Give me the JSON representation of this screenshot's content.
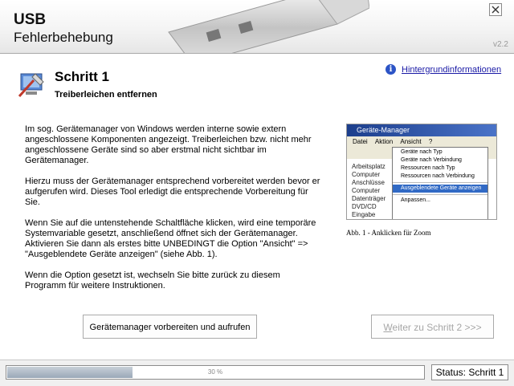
{
  "header": {
    "title": "USB",
    "subtitle": "Fehlerbehebung",
    "version": "v2.2",
    "close_glyph": "×"
  },
  "step": {
    "title": "Schritt 1",
    "subtitle": "Treiberleichen entfernen",
    "info_link": "Hintergrundinformationen",
    "info_glyph": "i"
  },
  "body": {
    "paragraphs": [
      "Im sog. Gerätemanager von Windows werden interne sowie extern angeschlossene Komponenten angezeigt. Treiberleichen bzw. nicht mehr angeschlossene Geräte sind so aber erstmal nicht sichtbar im Gerätemanager.",
      "Hierzu muss der Gerätemanager entsprechend vorbereitet werden bevor er aufgerufen wird. Dieses Tool erledigt die entsprechende Vorbereitung für Sie.",
      "Wenn Sie auf die untenstehende Schaltfläche klicken, wird eine temporäre Systemvariable gesetzt, anschließend öffnet sich der Gerätemanager. Aktivieren Sie dann als erstes bitte UNBEDINGT die Option \"Ansicht\" => \"Ausgeblendete Geräte anzeigen\" (siehe Abb. 1).",
      "Wenn die Option gesetzt ist, wechseln Sie bitte zurück zu diesem Programm für weitere Instruktionen."
    ]
  },
  "figure": {
    "window_title": "Geräte-Manager",
    "menu": [
      "Datei",
      "Aktion",
      "Ansicht",
      "?"
    ],
    "dropdown": [
      "Geräte nach Typ",
      "Geräte nach Verbindung",
      "Ressourcen nach Typ",
      "Ressourcen nach Verbindung",
      "Ausgeblendete Geräte anzeigen",
      "Anpassen..."
    ],
    "tree": [
      "Arbeitsplatz",
      "Computer",
      "Anschlüsse",
      "Computer",
      "Datenträger",
      "DVD/CD",
      "Eingabe"
    ],
    "caption": "Abb. 1 - Anklicken für Zoom"
  },
  "buttons": {
    "prepare": "Gerätemanager vorbereiten und aufrufen",
    "next_underlined": "W",
    "next_rest": "eiter zu Schritt 2  >>>"
  },
  "footer": {
    "progress_text": "30 %",
    "progress_value": 0.3,
    "status": "Status: Schritt 1"
  }
}
